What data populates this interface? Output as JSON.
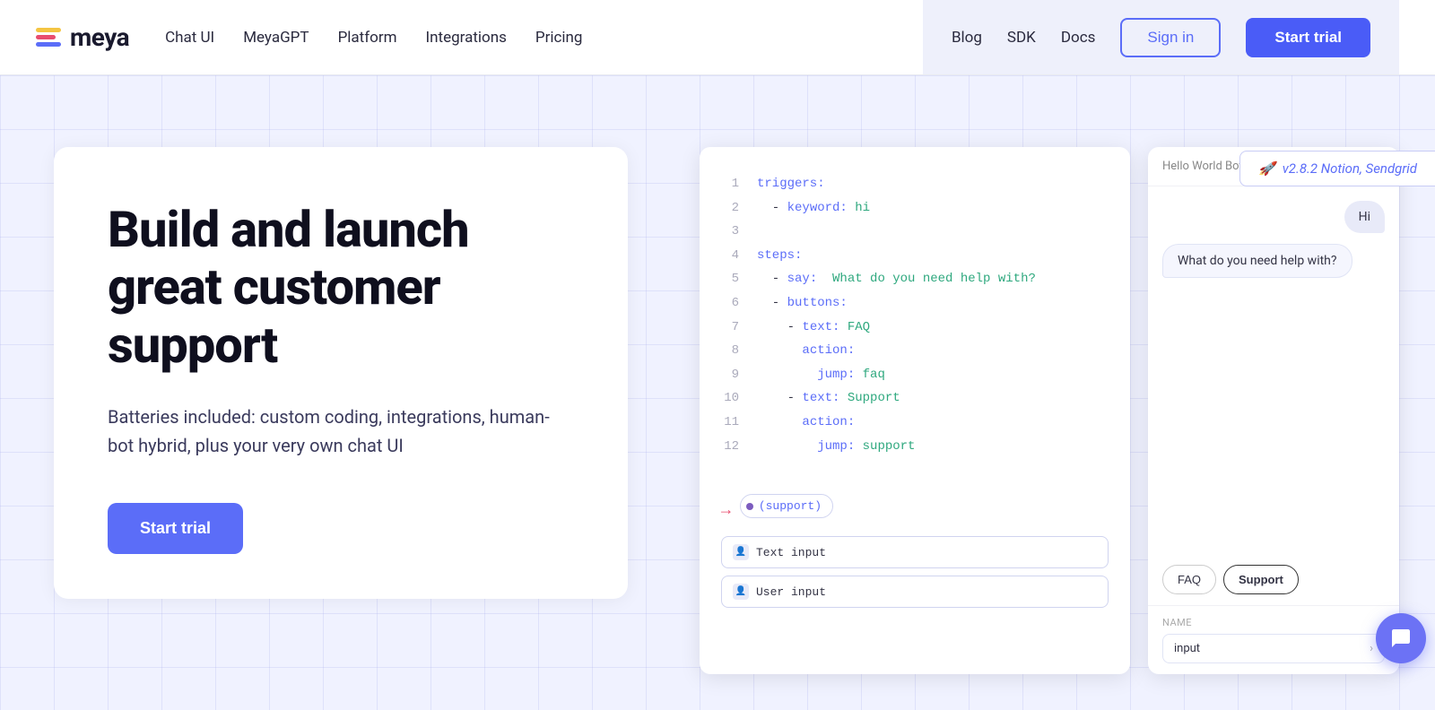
{
  "header": {
    "logo_text": "meya",
    "nav_items": [
      {
        "label": "Chat UI",
        "id": "chat-ui"
      },
      {
        "label": "MeyaGPT",
        "id": "meyagpt"
      },
      {
        "label": "Platform",
        "id": "platform"
      },
      {
        "label": "Integrations",
        "id": "integrations"
      },
      {
        "label": "Pricing",
        "id": "pricing"
      }
    ],
    "right_links": [
      {
        "label": "Blog",
        "id": "blog"
      },
      {
        "label": "SDK",
        "id": "sdk"
      },
      {
        "label": "Docs",
        "id": "docs"
      }
    ],
    "signin_label": "Sign in",
    "start_trial_label": "Start trial"
  },
  "version_banner": {
    "icon": "🚀",
    "text": "v2.8.2 Notion, Sendgrid"
  },
  "hero": {
    "title": "Build and launch great customer support",
    "subtitle": "Batteries included: custom coding, integrations, human-bot hybrid, plus your very own chat UI",
    "cta_label": "Start trial"
  },
  "code_editor": {
    "lines": [
      {
        "num": "1",
        "content": "triggers:"
      },
      {
        "num": "2",
        "content": "  - keyword: hi"
      },
      {
        "num": "3",
        "content": ""
      },
      {
        "num": "4",
        "content": "steps:"
      },
      {
        "num": "5",
        "content": "  - say:  What do you need help with?"
      },
      {
        "num": "6",
        "content": "  - buttons:"
      },
      {
        "num": "7",
        "content": "    - text: FAQ"
      },
      {
        "num": "8",
        "content": "      action:"
      },
      {
        "num": "9",
        "content": "        jump: faq"
      },
      {
        "num": "10",
        "content": "    - text: Support"
      },
      {
        "num": "11",
        "content": "      action:"
      },
      {
        "num": "12",
        "content": "        jump: support"
      }
    ]
  },
  "chat": {
    "bot_name": "Hello World Bot",
    "messages": [
      {
        "type": "user",
        "text": "Hi"
      },
      {
        "type": "bot",
        "text": "What do you need help with?"
      }
    ],
    "buttons": [
      {
        "label": "FAQ"
      },
      {
        "label": "Support",
        "active": true
      }
    ],
    "input_label": "NAME",
    "input_placeholder": "input"
  },
  "flow": {
    "badge_text": "(support)",
    "nodes": [
      {
        "icon": "👤",
        "label": "Text input"
      },
      {
        "icon": "👤",
        "label": "User input"
      }
    ]
  },
  "fab": {
    "icon": "💬"
  }
}
